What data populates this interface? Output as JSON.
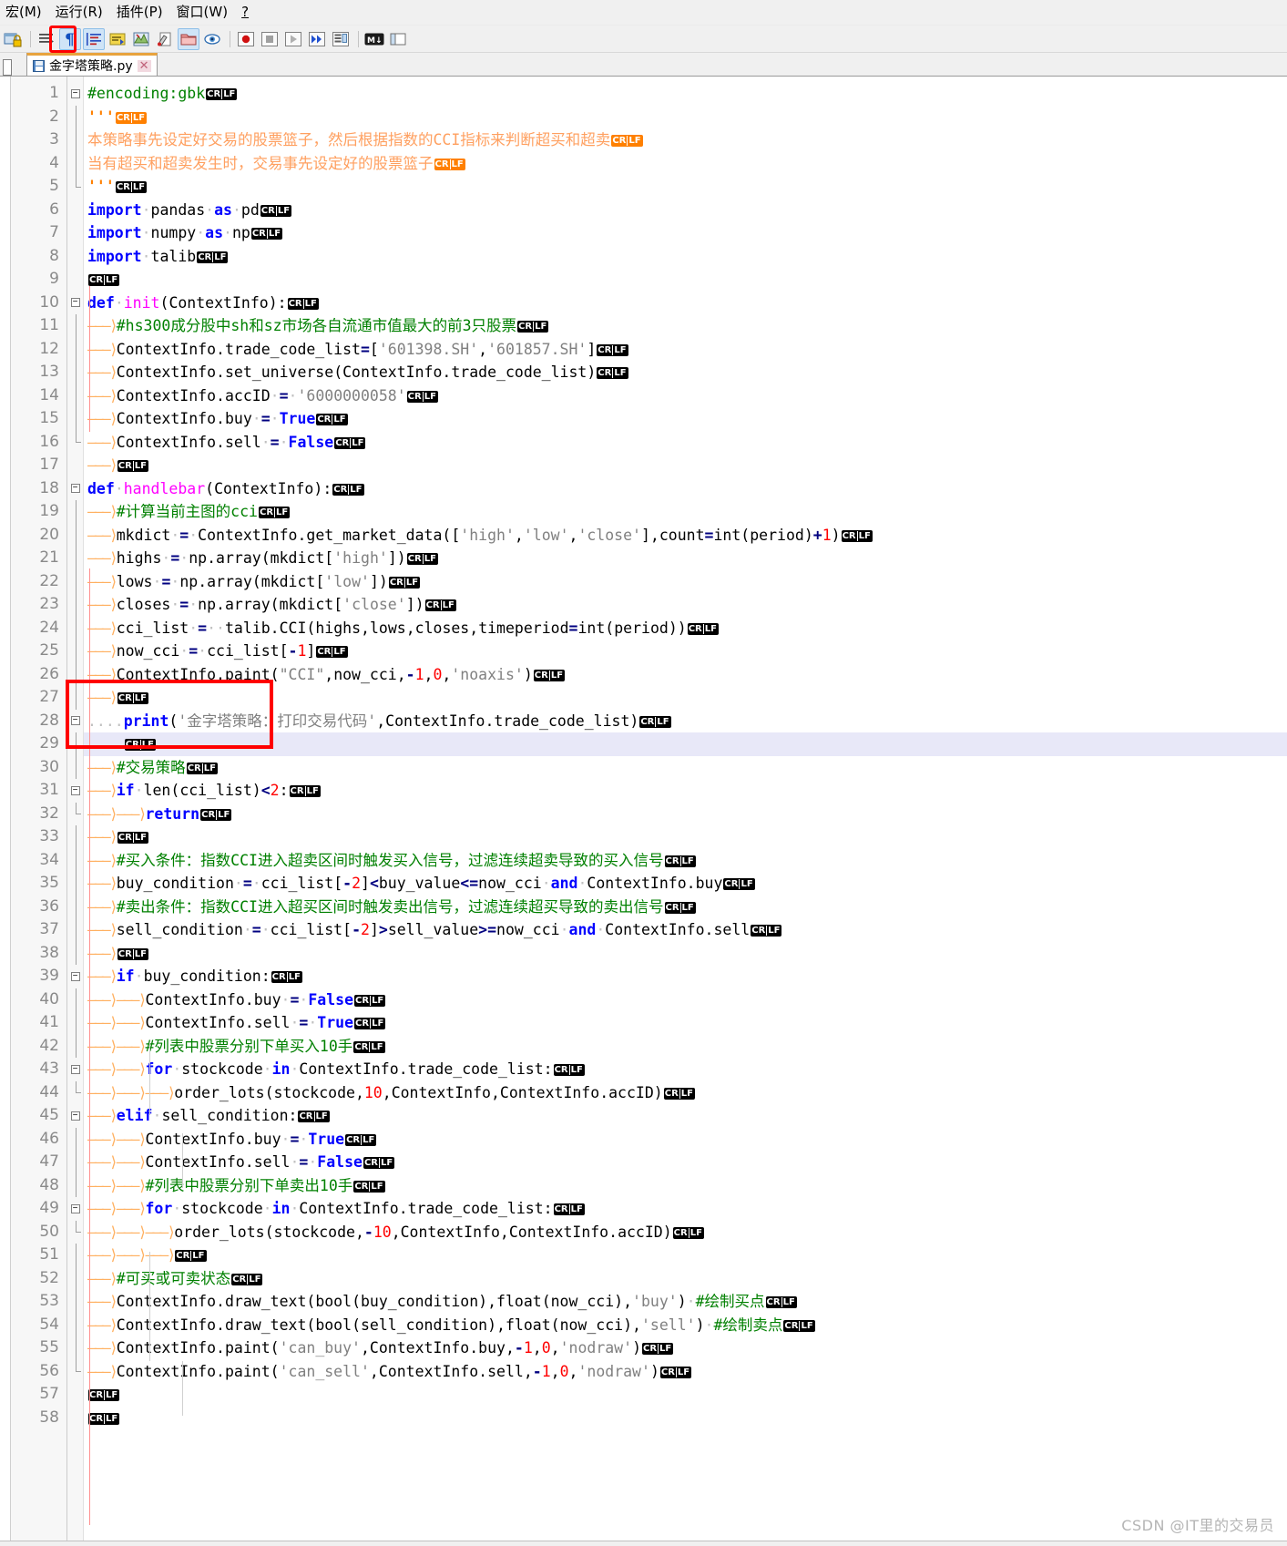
{
  "menu": {
    "items": [
      {
        "label": "宏(M)",
        "mnemonic": "M"
      },
      {
        "label": "运行(R)",
        "mnemonic": "R"
      },
      {
        "label": "插件(P)",
        "mnemonic": "P"
      },
      {
        "label": "窗口(W)",
        "mnemonic": "W"
      },
      {
        "label": "?",
        "mnemonic": ""
      }
    ]
  },
  "toolbar": {
    "buttons": [
      {
        "name": "macro-record-lock-icon",
        "selected": false
      },
      {
        "name": "indent-icon",
        "selected": false
      },
      {
        "name": "show-all-characters-icon",
        "selected": true,
        "highlighted": true
      },
      {
        "name": "show-indent-guide-icon",
        "selected": true
      },
      {
        "name": "word-wrap-icon",
        "selected": false
      },
      {
        "name": "zoom-map-icon",
        "selected": false
      },
      {
        "name": "style-config-icon",
        "selected": false
      },
      {
        "name": "open-folder-icon",
        "selected": true
      },
      {
        "name": "document-map-icon",
        "selected": false
      },
      {
        "name": "macro-record-icon",
        "selected": false
      },
      {
        "name": "macro-stop-icon",
        "selected": false
      },
      {
        "name": "macro-play-icon",
        "selected": false
      },
      {
        "name": "macro-playback-multiple-icon",
        "selected": false
      },
      {
        "name": "run-macro-dialog-icon",
        "selected": false
      },
      {
        "name": "markdown-icon",
        "selected": false
      },
      {
        "name": "panel-icon",
        "selected": false
      }
    ],
    "highlight_color": "#ff0000"
  },
  "tab": {
    "filename": "金字塔策略.py",
    "close_label": "✕",
    "save_icon": "floppy-disk-icon"
  },
  "editor": {
    "current_line": 29,
    "annotation": {
      "color": "#ff0000",
      "covers_lines": [
        27,
        29
      ]
    },
    "lines": [
      {
        "n": 1,
        "fold": "open",
        "text": "#encoding:gbk",
        "crlf": "black"
      },
      {
        "n": 2,
        "fold": "bar",
        "text": "'''",
        "crlf": "orange"
      },
      {
        "n": 3,
        "fold": "bar",
        "text": "本策略事先设定好交易的股票篮子，然后根据指数的CCI指标来判断超买和超卖",
        "crlf": "orange"
      },
      {
        "n": 4,
        "fold": "bar",
        "text": "当有超买和超卖发生时，交易事先设定好的股票篮子",
        "crlf": "orange"
      },
      {
        "n": 5,
        "fold": "end",
        "text": "'''",
        "crlf": "black"
      },
      {
        "n": 6,
        "fold": "none",
        "text": "import pandas as pd",
        "crlf": "black"
      },
      {
        "n": 7,
        "fold": "none",
        "text": "import numpy as np",
        "crlf": "black"
      },
      {
        "n": 8,
        "fold": "none",
        "text": "import talib",
        "crlf": "black"
      },
      {
        "n": 9,
        "fold": "none",
        "text": "",
        "crlf": "black"
      },
      {
        "n": 10,
        "fold": "open",
        "text": "def init(ContextInfo):",
        "crlf": "black"
      },
      {
        "n": 11,
        "fold": "bar",
        "text": "\t#hs300成分股中sh和sz市场各自流通市值最大的前3只股票",
        "crlf": "black"
      },
      {
        "n": 12,
        "fold": "bar",
        "text": "\tContextInfo.trade_code_list=['601398.SH','601857.SH']",
        "crlf": "black"
      },
      {
        "n": 13,
        "fold": "bar",
        "text": "\tContextInfo.set_universe(ContextInfo.trade_code_list)",
        "crlf": "black"
      },
      {
        "n": 14,
        "fold": "bar",
        "text": "\tContextInfo.accID = '6000000058'",
        "crlf": "black"
      },
      {
        "n": 15,
        "fold": "bar",
        "text": "\tContextInfo.buy = True",
        "crlf": "black"
      },
      {
        "n": 16,
        "fold": "end",
        "text": "\tContextInfo.sell = False",
        "crlf": "black"
      },
      {
        "n": 17,
        "fold": "none",
        "text": "\t",
        "crlf": "black"
      },
      {
        "n": 18,
        "fold": "open",
        "text": "def handlebar(ContextInfo):",
        "crlf": "black"
      },
      {
        "n": 19,
        "fold": "bar",
        "text": "\t#计算当前主图的cci",
        "crlf": "black"
      },
      {
        "n": 20,
        "fold": "bar",
        "text": "\tmkdict = ContextInfo.get_market_data(['high','low','close'],count=int(period)+1)",
        "crlf": "black"
      },
      {
        "n": 21,
        "fold": "bar",
        "text": "\thighs = np.array(mkdict['high'])",
        "crlf": "black"
      },
      {
        "n": 22,
        "fold": "bar",
        "text": "\tlows = np.array(mkdict['low'])",
        "crlf": "black"
      },
      {
        "n": 23,
        "fold": "bar",
        "text": "\tcloses = np.array(mkdict['close'])",
        "crlf": "black"
      },
      {
        "n": 24,
        "fold": "bar",
        "text": "\tcci_list =  talib.CCI(highs,lows,closes,timeperiod=int(period))",
        "crlf": "black"
      },
      {
        "n": 25,
        "fold": "bar",
        "text": "\tnow_cci = cci_list[-1]",
        "crlf": "black"
      },
      {
        "n": 26,
        "fold": "bar",
        "text": "\tContextInfo.paint(\"CCI\",now_cci,-1,0,'noaxis')",
        "crlf": "black"
      },
      {
        "n": 27,
        "fold": "bar",
        "text": "\t",
        "crlf": "black"
      },
      {
        "n": 28,
        "fold": "open",
        "text": "....print('金字塔策略：打印交易代码',ContextInfo.trade_code_list)",
        "crlf": "black"
      },
      {
        "n": 29,
        "fold": "bar",
        "text": "....",
        "crlf": "black",
        "current": true
      },
      {
        "n": 30,
        "fold": "bar",
        "text": "\t#交易策略",
        "crlf": "black"
      },
      {
        "n": 31,
        "fold": "open",
        "text": "\tif len(cci_list)<2:",
        "crlf": "black"
      },
      {
        "n": 32,
        "fold": "end",
        "text": "\t\treturn",
        "crlf": "black"
      },
      {
        "n": 33,
        "fold": "bar",
        "text": "\t",
        "crlf": "black"
      },
      {
        "n": 34,
        "fold": "bar",
        "text": "\t#买入条件：指数CCI进入超卖区间时触发买入信号，过滤连续超卖导致的买入信号",
        "crlf": "black"
      },
      {
        "n": 35,
        "fold": "bar",
        "text": "\tbuy_condition = cci_list[-2]<buy_value<=now_cci and ContextInfo.buy",
        "crlf": "black"
      },
      {
        "n": 36,
        "fold": "bar",
        "text": "\t#卖出条件：指数CCI进入超买区间时触发卖出信号，过滤连续超买导致的卖出信号",
        "crlf": "black"
      },
      {
        "n": 37,
        "fold": "bar",
        "text": "\tsell_condition = cci_list[-2]>sell_value>=now_cci and ContextInfo.sell",
        "crlf": "black"
      },
      {
        "n": 38,
        "fold": "bar",
        "text": "\t",
        "crlf": "black"
      },
      {
        "n": 39,
        "fold": "open",
        "text": "\tif buy_condition:",
        "crlf": "black"
      },
      {
        "n": 40,
        "fold": "bar",
        "text": "\t\tContextInfo.buy = False",
        "crlf": "black"
      },
      {
        "n": 41,
        "fold": "bar",
        "text": "\t\tContextInfo.sell = True",
        "crlf": "black"
      },
      {
        "n": 42,
        "fold": "bar",
        "text": "\t\t#列表中股票分别下单买入10手",
        "crlf": "black"
      },
      {
        "n": 43,
        "fold": "open",
        "text": "\t\tfor stockcode in ContextInfo.trade_code_list:",
        "crlf": "black"
      },
      {
        "n": 44,
        "fold": "end",
        "text": "\t\t\torder_lots(stockcode,10,ContextInfo,ContextInfo.accID)",
        "crlf": "black"
      },
      {
        "n": 45,
        "fold": "open",
        "text": "\telif sell_condition:",
        "crlf": "black"
      },
      {
        "n": 46,
        "fold": "bar",
        "text": "\t\tContextInfo.buy = True",
        "crlf": "black"
      },
      {
        "n": 47,
        "fold": "bar",
        "text": "\t\tContextInfo.sell = False",
        "crlf": "black"
      },
      {
        "n": 48,
        "fold": "bar",
        "text": "\t\t#列表中股票分别下单卖出10手",
        "crlf": "black"
      },
      {
        "n": 49,
        "fold": "open",
        "text": "\t\tfor stockcode in ContextInfo.trade_code_list:",
        "crlf": "black"
      },
      {
        "n": 50,
        "fold": "end",
        "text": "\t\t\torder_lots(stockcode,-10,ContextInfo,ContextInfo.accID)",
        "crlf": "black"
      },
      {
        "n": 51,
        "fold": "bar",
        "text": "\t\t\t",
        "crlf": "black"
      },
      {
        "n": 52,
        "fold": "bar",
        "text": "\t#可买或可卖状态",
        "crlf": "black"
      },
      {
        "n": 53,
        "fold": "bar",
        "text": "\tContextInfo.draw_text(bool(buy_condition),float(now_cci),'buy') #绘制买点",
        "crlf": "black"
      },
      {
        "n": 54,
        "fold": "bar",
        "text": "\tContextInfo.draw_text(bool(sell_condition),float(now_cci),'sell') #绘制卖点",
        "crlf": "black"
      },
      {
        "n": 55,
        "fold": "bar",
        "text": "\tContextInfo.paint('can_buy',ContextInfo.buy,-1,0,'nodraw')",
        "crlf": "black"
      },
      {
        "n": 56,
        "fold": "end",
        "text": "\tContextInfo.paint('can_sell',ContextInfo.sell,-1,0,'nodraw')",
        "crlf": "black"
      },
      {
        "n": 57,
        "fold": "none",
        "text": "",
        "crlf": "black"
      },
      {
        "n": 58,
        "fold": "none",
        "text": "",
        "crlf": "black"
      }
    ]
  },
  "whitespace": {
    "cr_label": "CR",
    "lf_label": "LF",
    "tab_glyph": "⟶",
    "space_glyph": "·"
  },
  "watermark": {
    "text": "CSDN @IT里的交易员"
  },
  "colors": {
    "keyword": "#0000ff",
    "function": "#ff00ff",
    "comment": "#008000",
    "docstring_comment": "#ffa060",
    "string": "#808080",
    "number": "#ff0000",
    "operator": "#000080",
    "annotation": "#ff0000",
    "current_line_bg": "#e8e8f8"
  }
}
